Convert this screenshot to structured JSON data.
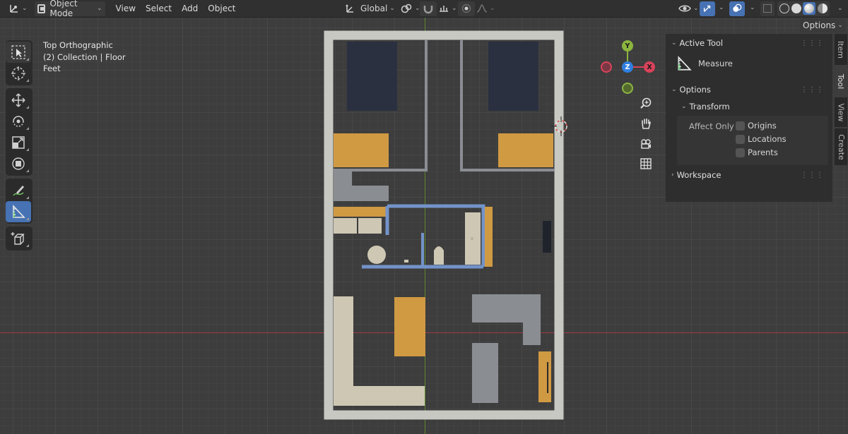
{
  "header": {
    "mode": "Object Mode",
    "menus": [
      "View",
      "Select",
      "Add",
      "Object"
    ],
    "orientation": "Global",
    "options": "Options"
  },
  "viewport": {
    "view_name": "Top Orthographic",
    "collection": "(2) Collection | Floor",
    "units": "Feet"
  },
  "gizmo": {
    "x": "X",
    "y": "Y",
    "z": "Z"
  },
  "sidebar": {
    "active_tool_title": "Active Tool",
    "active_tool_name": "Measure",
    "options_title": "Options",
    "transform_title": "Transform",
    "affect_only": "Affect Only",
    "checkboxes": [
      "Origins",
      "Locations",
      "Parents"
    ],
    "workspace_title": "Workspace"
  },
  "tabs": [
    "Item",
    "Tool",
    "View",
    "Create"
  ],
  "colors": {
    "accent": "#4772b3",
    "wall": "#c8c8c2",
    "furniture": "#d09a43",
    "bed": "#2a3040",
    "counter": "#8a8d92",
    "partition": "#7393c9",
    "beige": "#cdc7b4"
  }
}
